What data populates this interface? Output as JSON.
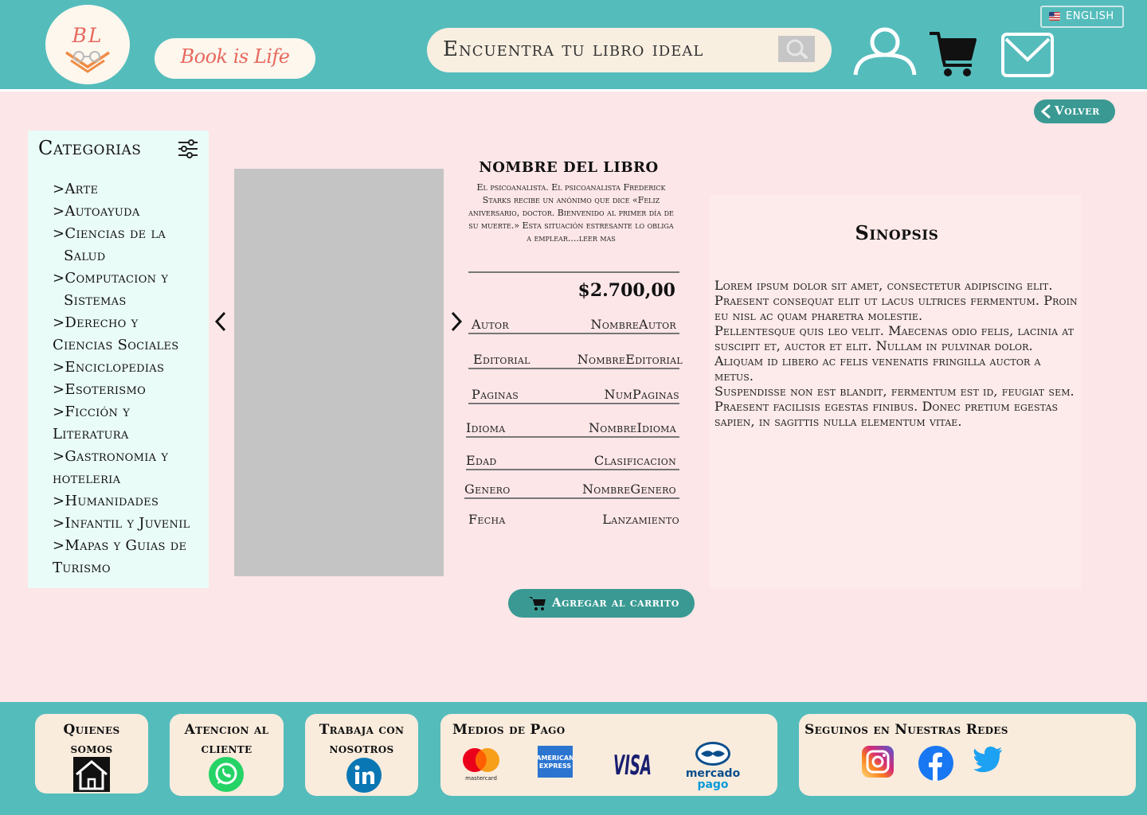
{
  "header": {
    "logo_text": "BL",
    "brand_name": "Book is Life",
    "search_placeholder": "Encuentra tu libro ideal",
    "language_label": "ENGLISH",
    "icons": [
      "user-icon",
      "cart-icon",
      "mail-icon",
      "search-icon",
      "us-flag-icon"
    ]
  },
  "back_button": {
    "label": "Volver",
    "icon": "chevron-left-icon"
  },
  "sidebar": {
    "title": "Categorias",
    "filter_icon": "sliders-icon",
    "categories": [
      {
        "label": ">Arte"
      },
      {
        "label": ">Autoayuda"
      },
      {
        "label": ">Ciencias de la",
        "label2": "Salud"
      },
      {
        "label": ">Computacion y",
        "label2": "Sistemas"
      },
      {
        "label": ">Derecho y",
        "label2": "Ciencias Sociales"
      },
      {
        "label": ">Enciclopedias"
      },
      {
        "label": ">Esoterismo"
      },
      {
        "label": ">Ficción y",
        "label2": "Literatura"
      },
      {
        "label": ">Gastronomia y",
        "label2": "hoteleria"
      },
      {
        "label": ">Humanidades"
      },
      {
        "label": ">Infantil y Juvenil"
      },
      {
        "label": ">Mapas y Guias de",
        "label2": "Turismo"
      }
    ]
  },
  "book": {
    "title": "NOMBRE DEL LIBRO",
    "summary": "El psicoanalista. El psicoanalista Frederick Starks recibe un anónimo que dice «Feliz aniversario, doctor. Bienvenido al primer día de su muerte.» Esta situación estresante lo obliga a emplear....leer mas",
    "price": "$2.700,00",
    "specs": [
      {
        "key": "Autor",
        "value": "NombreAutor"
      },
      {
        "key": "Editorial",
        "value": "NombreEditorial"
      },
      {
        "key": "Paginas",
        "value": "NumPaginas"
      },
      {
        "key": "Idioma",
        "value": "NombreIdioma"
      },
      {
        "key": "Edad",
        "value": "Clasificacion"
      },
      {
        "key": "Genero",
        "value": "NombreGenero"
      },
      {
        "key": "Fecha",
        "value": "Lanzamiento"
      }
    ],
    "add_to_cart_label": "Agregar al carrito"
  },
  "sinopsis": {
    "title": "Sinopsis",
    "paragraphs": [
      "Lorem ipsum dolor sit amet, consectetur adipiscing elit. Praesent consequat elit ut lacus ultrices fermentum. Proin eu nisl ac quam pharetra molestie.",
      " Pellentesque quis leo velit. Maecenas odio felis, lacinia at suscipit et, auctor et elit. Nullam in pulvinar dolor. Aliquam id libero ac felis venenatis fringilla auctor a metus.",
      "Suspendisse non est blandit, fermentum est id, feugiat sem.  Praesent facilisis egestas finibus. Donec pretium egestas sapien, in sagittis nulla elementum vitae."
    ]
  },
  "footer": {
    "quienes_somos": {
      "line1": "Quienes",
      "line2": "somos",
      "icon": "home-icon"
    },
    "atencion": {
      "line1": "Atencion al",
      "line2": "cliente",
      "icon": "whatsapp-icon"
    },
    "trabaja": {
      "line1": "Trabaja con",
      "line2": "nosotros",
      "icon": "linkedin-icon"
    },
    "pagos": {
      "title": "Medios de Pago",
      "mastercard_label": "mastercard",
      "amex_line1": "AMERICAN",
      "amex_line2": "EXPRESS",
      "visa_label": "VISA",
      "mp_line1": "mercado",
      "mp_line2": "pago"
    },
    "redes": {
      "title": "Seguinos en Nuestras Redes",
      "icons": [
        "instagram-icon",
        "facebook-icon",
        "twitter-icon"
      ]
    }
  },
  "colors": {
    "teal": "#55bcbc",
    "dark_teal": "#3a9a93",
    "pink_bg": "#fde6e8",
    "cream": "#f9ecdd",
    "brand_coral": "#e8695e"
  }
}
